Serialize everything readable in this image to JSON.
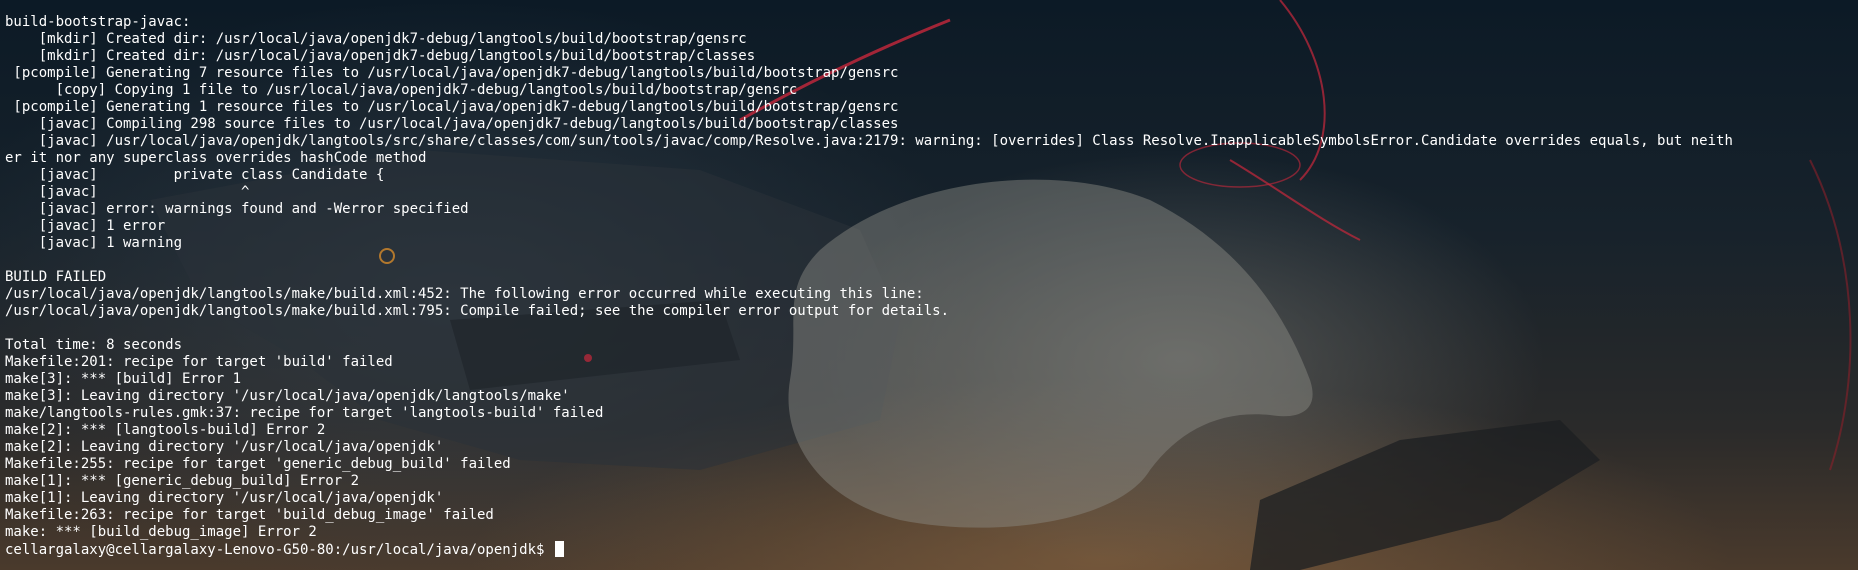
{
  "terminal": {
    "lines": [
      "build-bootstrap-javac:",
      "    [mkdir] Created dir: /usr/local/java/openjdk7-debug/langtools/build/bootstrap/gensrc",
      "    [mkdir] Created dir: /usr/local/java/openjdk7-debug/langtools/build/bootstrap/classes",
      " [pcompile] Generating 7 resource files to /usr/local/java/openjdk7-debug/langtools/build/bootstrap/gensrc",
      "      [copy] Copying 1 file to /usr/local/java/openjdk7-debug/langtools/build/bootstrap/gensrc",
      " [pcompile] Generating 1 resource files to /usr/local/java/openjdk7-debug/langtools/build/bootstrap/gensrc",
      "    [javac] Compiling 298 source files to /usr/local/java/openjdk7-debug/langtools/build/bootstrap/classes",
      "    [javac] /usr/local/java/openjdk/langtools/src/share/classes/com/sun/tools/javac/comp/Resolve.java:2179: warning: [overrides] Class Resolve.InapplicableSymbolsError.Candidate overrides equals, but neith",
      "er it nor any superclass overrides hashCode method",
      "    [javac]         private class Candidate {",
      "    [javac]                 ^",
      "    [javac] error: warnings found and -Werror specified",
      "    [javac] 1 error",
      "    [javac] 1 warning",
      "",
      "BUILD FAILED",
      "/usr/local/java/openjdk/langtools/make/build.xml:452: The following error occurred while executing this line:",
      "/usr/local/java/openjdk/langtools/make/build.xml:795: Compile failed; see the compiler error output for details.",
      "",
      "Total time: 8 seconds",
      "Makefile:201: recipe for target 'build' failed",
      "make[3]: *** [build] Error 1",
      "make[3]: Leaving directory '/usr/local/java/openjdk/langtools/make'",
      "make/langtools-rules.gmk:37: recipe for target 'langtools-build' failed",
      "make[2]: *** [langtools-build] Error 2",
      "make[2]: Leaving directory '/usr/local/java/openjdk'",
      "Makefile:255: recipe for target 'generic_debug_build' failed",
      "make[1]: *** [generic_debug_build] Error 2",
      "make[1]: Leaving directory '/usr/local/java/openjdk'",
      "Makefile:263: recipe for target 'build_debug_image' failed",
      "make: *** [build_debug_image] Error 2"
    ],
    "prompt": "cellargalaxy@cellargalaxy-Lenovo-G50-80:/usr/local/java/openjdk$ "
  },
  "colors": {
    "text": "#ffffff",
    "background": "#0d1620",
    "accent_red": "#c8283c"
  }
}
